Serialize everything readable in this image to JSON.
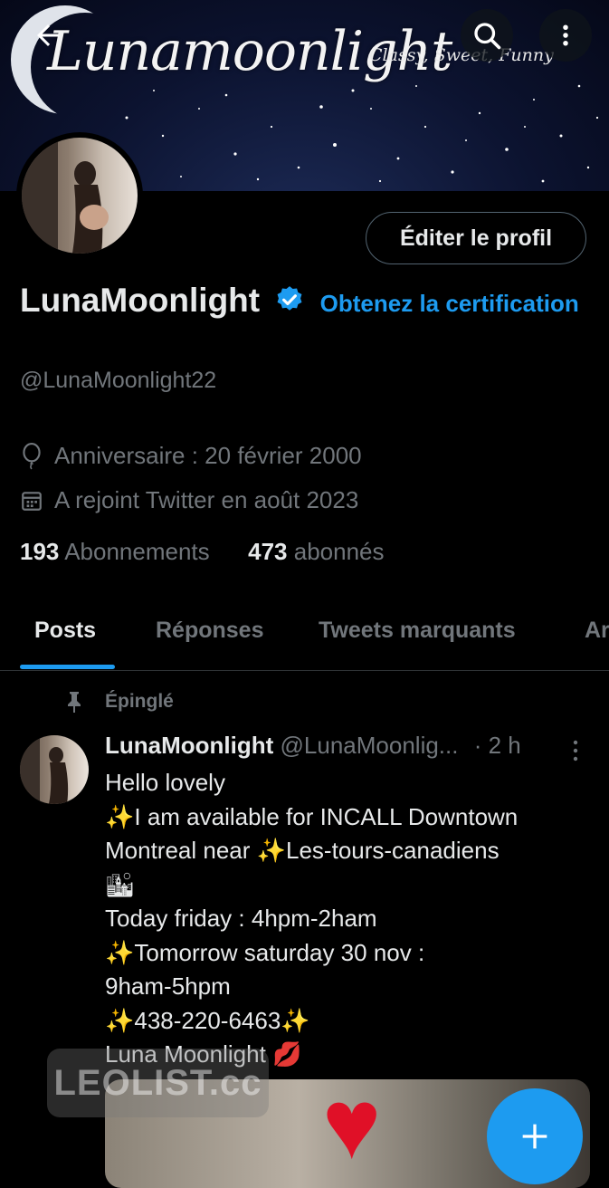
{
  "banner": {
    "title": "Lunamoonlight",
    "tagline": "Classy, Sweet, Funny"
  },
  "header": {
    "back_icon": "arrow-left-icon",
    "search_icon": "search-icon",
    "more_icon": "more-vertical-icon"
  },
  "profile": {
    "edit_label": "Éditer le profil",
    "display_name": "LunaMoonlight",
    "verify_link": "Obtenez la certification",
    "handle": "@LunaMoonlight22",
    "birthday": "Anniversaire : 20 février 2000",
    "joined": "A rejoint Twitter en août 2023",
    "following_count": "193",
    "following_label": "Abonnements",
    "followers_count": "473",
    "followers_label": "abonnés"
  },
  "tabs": [
    {
      "label": "Posts",
      "active": true
    },
    {
      "label": "Réponses",
      "active": false
    },
    {
      "label": "Tweets marquants",
      "active": false
    },
    {
      "label": "Ar",
      "active": false
    }
  ],
  "tweet": {
    "pinned_label": "Épinglé",
    "author_name": "LunaMoonlight",
    "author_handle": "@LunaMoonlig...",
    "time": "· 2 h",
    "lines": [
      "Hello lovely",
      "✨I am available for INCALL Downtown",
      "Montreal  near ✨Les-tours-canadiens",
      "🏙",
      "Today friday : 4hpm-2ham",
      "✨Tomorrow saturday 30 nov :",
      "9ham-5hpm",
      "✨438-220-6463✨",
      "Luna Moonlight 💋"
    ]
  },
  "watermark": "LEOLIST.cc",
  "colors": {
    "accent": "#1d9bf0",
    "background": "#000000",
    "text": "#e7e9ea",
    "muted": "#71767b"
  }
}
